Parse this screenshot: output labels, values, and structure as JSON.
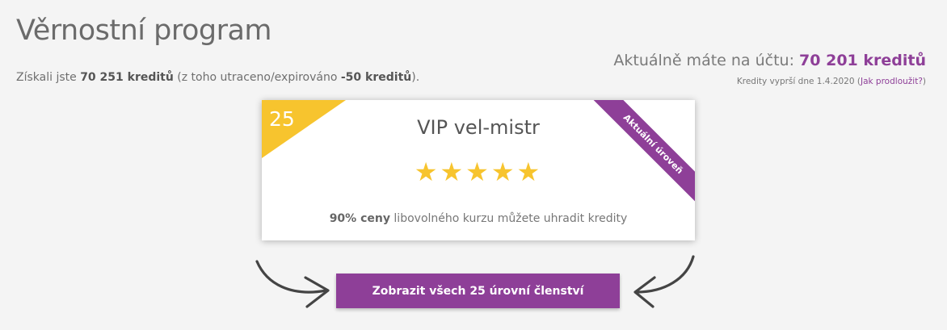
{
  "page": {
    "title": "Věrnostní program"
  },
  "earned": {
    "prefix": "Získali jste",
    "amount": "70 251 kreditů",
    "middle": "(z toho utraceno/expirováno",
    "spent": "-50 kreditů",
    "suffix": ")."
  },
  "balance": {
    "label": "Aktuálně máte na účtu:",
    "amount": "70 201 kreditů"
  },
  "expiry": {
    "text": "Kredity vyprší dne 1.4.2020 (",
    "link": "Jak prodloužit?",
    "close": ")"
  },
  "level": {
    "number": "25",
    "name": "VIP vel-mistr",
    "stars": "★★★★★",
    "stars_count": 5,
    "ribbon": "Aktuální úroveň",
    "benefit_bold": "90% ceny",
    "benefit_rest": "libovolného kurzu můžete uhradit kredity"
  },
  "cta": {
    "label": "Zobrazit všech 25 úrovní členství"
  },
  "colors": {
    "accent": "#8e3f98",
    "badge": "#f7c42e",
    "background": "#f4f4f4"
  },
  "icons": {
    "left_arrow": "curved-arrow-right-icon",
    "right_arrow": "curved-arrow-left-icon",
    "star": "star-icon"
  }
}
